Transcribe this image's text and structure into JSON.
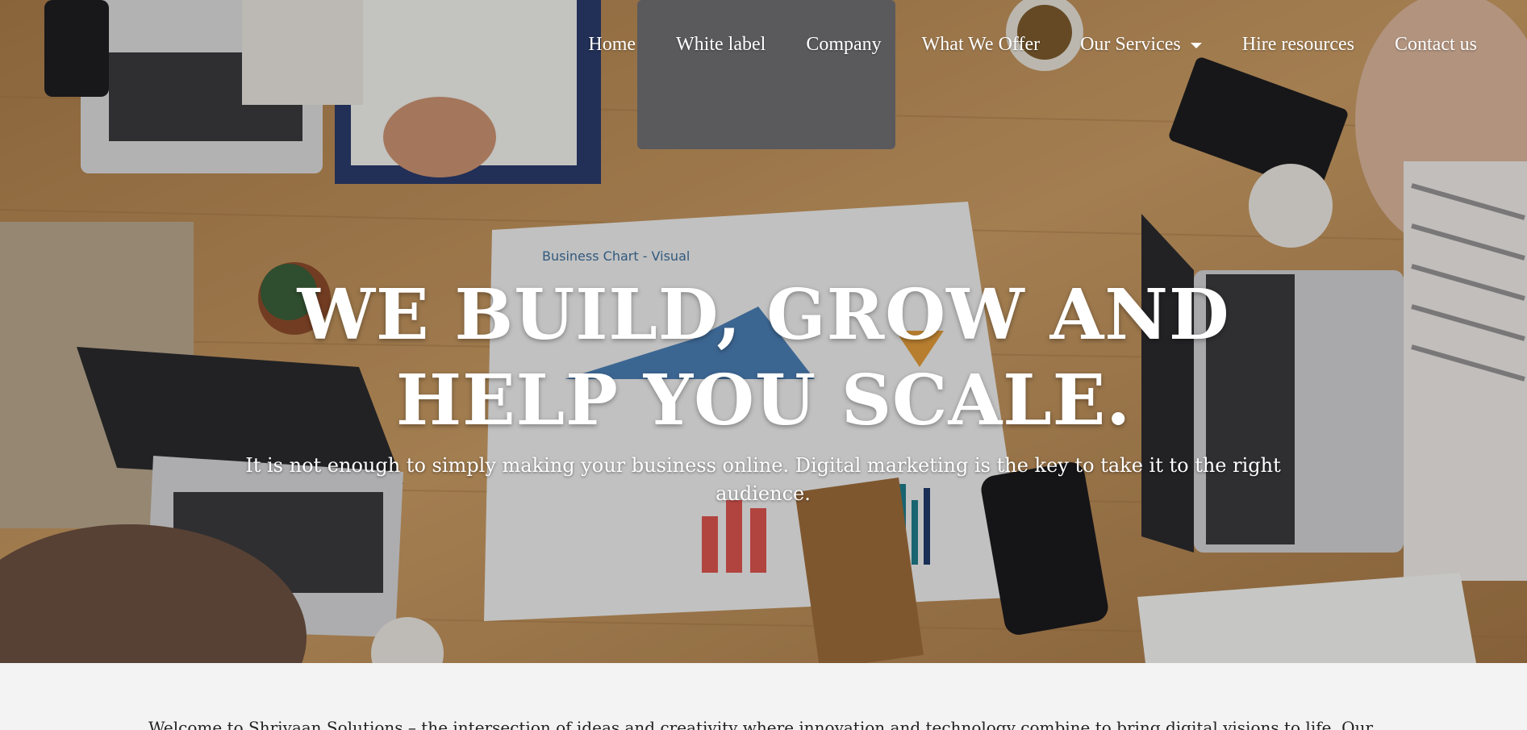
{
  "nav": {
    "items": [
      {
        "label": "Home"
      },
      {
        "label": "White label"
      },
      {
        "label": "Company"
      },
      {
        "label": "What We Offer"
      },
      {
        "label": "Our Services"
      },
      {
        "label": "Hire resources"
      },
      {
        "label": "Contact us"
      }
    ]
  },
  "hero": {
    "title_line1": "WE BUILD, GROW AND",
    "title_line2": "HELP YOU SCALE.",
    "subtitle": "It is not enough to simply making your business online. Digital marketing is the key to take it to the right audience."
  },
  "intro": {
    "text": "Welcome to Shrivaan Solutions – the intersection of ideas and creativity where innovation and technology combine to bring digital visions to life. Our"
  },
  "colors": {
    "nav_text": "#ffffff",
    "hero_text": "#ffffff",
    "page_bg": "#f3f3f3",
    "body_text": "#222222"
  }
}
